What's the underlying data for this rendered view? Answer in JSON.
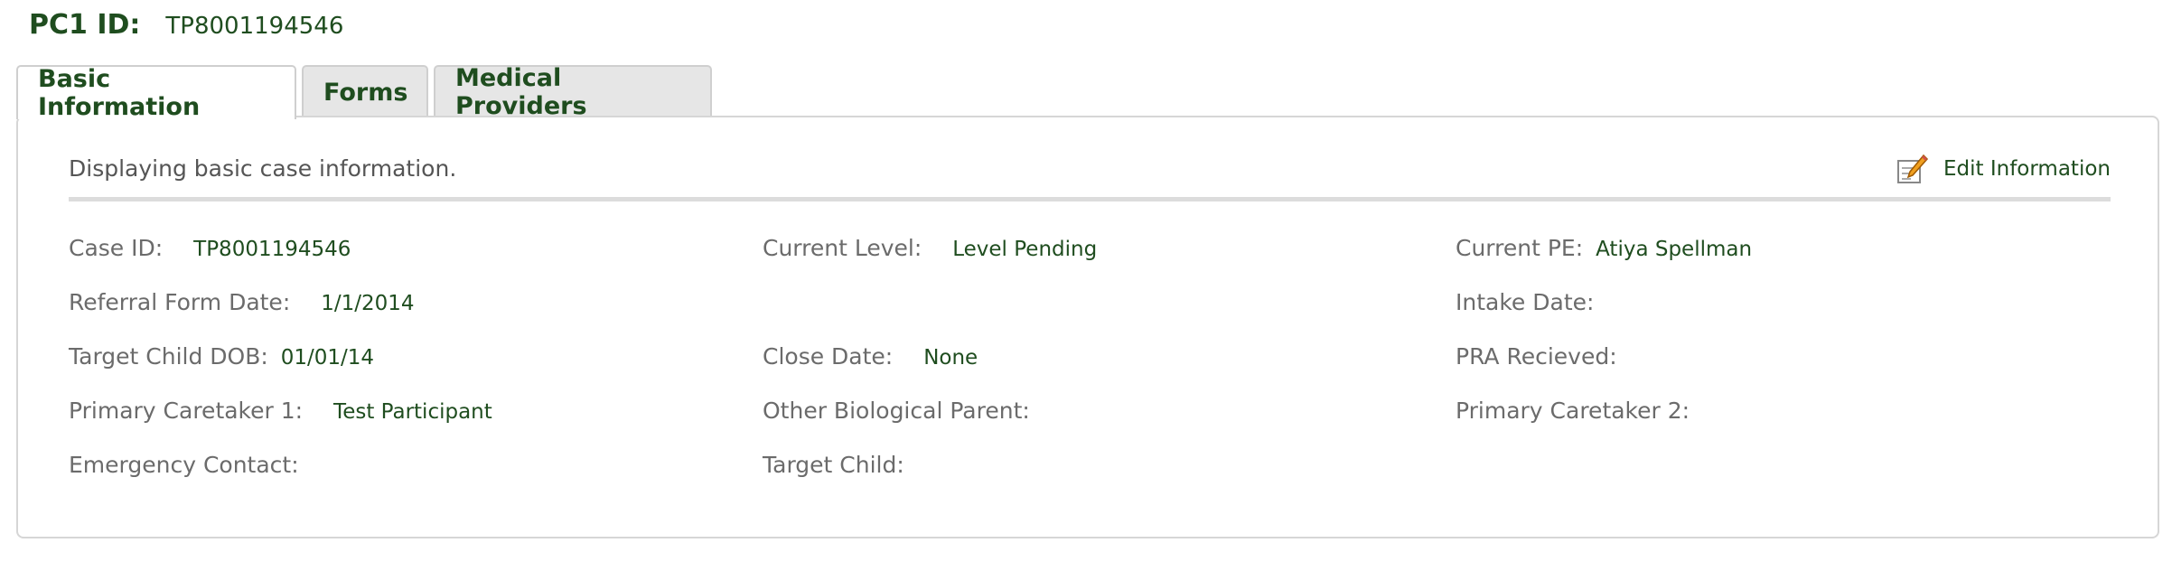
{
  "header": {
    "label": "PC1 ID:",
    "value": "TP8001194546"
  },
  "tabs": [
    "Basic Information",
    "Forms",
    "Medical Providers"
  ],
  "panel": {
    "description": "Displaying basic case information.",
    "edit_label": "Edit Information",
    "icon": "edit-pencil-icon"
  },
  "fields": {
    "case_id": {
      "label": "Case ID:",
      "value": "TP8001194546"
    },
    "current_level": {
      "label": "Current Level:",
      "value": "Level Pending"
    },
    "current_pe": {
      "label": "Current PE:",
      "value": "Atiya Spellman"
    },
    "referral_form_date": {
      "label": "Referral Form Date:",
      "value": "1/1/2014"
    },
    "intake_date": {
      "label": "Intake Date:",
      "value": ""
    },
    "target_child_dob": {
      "label": "Target Child DOB:",
      "value": "01/01/14"
    },
    "close_date": {
      "label": "Close Date:",
      "value": "None"
    },
    "pra_received": {
      "label": "PRA Recieved:",
      "value": ""
    },
    "primary_caretaker_1": {
      "label": "Primary Caretaker 1:",
      "value": "Test Participant"
    },
    "other_biological_parent": {
      "label": "Other Biological Parent:",
      "value": ""
    },
    "primary_caretaker_2": {
      "label": "Primary Caretaker 2:",
      "value": ""
    },
    "emergency_contact": {
      "label": "Emergency Contact:",
      "value": ""
    },
    "target_child": {
      "label": "Target Child:",
      "value": ""
    }
  },
  "colors": {
    "accent": "#1f4d1f",
    "label": "#6b6b6b",
    "border": "#d6d6d6"
  }
}
